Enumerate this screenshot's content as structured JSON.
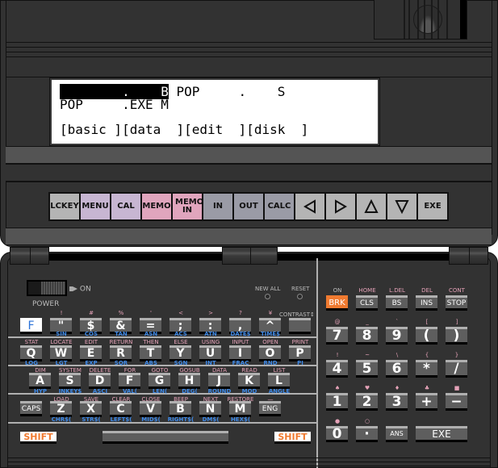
{
  "lcd": {
    "line1_inverse": "        .    B",
    "line1_rest": " POP     .    S",
    "line2": "POP     .EXE M",
    "line3": "[basic ][data  ][edit  ][disk  ]"
  },
  "function_keys": [
    {
      "label": "LCKEY",
      "color": "grey"
    },
    {
      "label": "MENU",
      "color": "lav"
    },
    {
      "label": "CAL",
      "color": "lav"
    },
    {
      "label": "MEMO",
      "color": "pink"
    },
    {
      "label": "MEMO IN",
      "color": "pink"
    },
    {
      "label": "IN",
      "color": "dark"
    },
    {
      "label": "OUT",
      "color": "dark"
    },
    {
      "label": "CALC",
      "color": "dark"
    },
    {
      "label": "",
      "icon": "left-arrow",
      "color": "grey"
    },
    {
      "label": "",
      "icon": "right-arrow",
      "color": "grey"
    },
    {
      "label": "",
      "icon": "up-arrow",
      "color": "grey"
    },
    {
      "label": "",
      "icon": "down-arrow",
      "color": "grey"
    },
    {
      "label": "EXE",
      "color": "grey"
    }
  ],
  "panel": {
    "power_label": "POWER",
    "on_label": "ON",
    "new_all_label": "NEW ALL",
    "reset_label": "RESET",
    "contrast_label": "CONTRAST"
  },
  "row1": [
    {
      "key": "F",
      "top": "",
      "bottom": ""
    },
    {
      "key": "\"",
      "top": "!",
      "bottom": "SIN"
    },
    {
      "key": "$",
      "top": "#",
      "bottom": "COS"
    },
    {
      "key": "&",
      "top": "%",
      "bottom": "TAN"
    },
    {
      "key": "=",
      "top": "'",
      "bottom": "ASN"
    },
    {
      "key": ";",
      "top": "<",
      "bottom": "ACS"
    },
    {
      "key": ":",
      "top": ">",
      "bottom": "ATN"
    },
    {
      "key": ",",
      "top": "?",
      "bottom": "DATE$"
    },
    {
      "key": "^",
      "top": "¥",
      "bottom": "TIME$"
    },
    {
      "key": "",
      "top": "",
      "bottom": ""
    }
  ],
  "row2": [
    {
      "key": "Q",
      "top": "STAT",
      "bottom": "LOG"
    },
    {
      "key": "W",
      "top": "LOCATE",
      "bottom": "LGT"
    },
    {
      "key": "E",
      "top": "EDIT",
      "bottom": "EXP"
    },
    {
      "key": "R",
      "top": "RETURN",
      "bottom": "SQR"
    },
    {
      "key": "T",
      "top": "THEN",
      "bottom": "ABS"
    },
    {
      "key": "Y",
      "top": "ELSE",
      "bottom": "SGN"
    },
    {
      "key": "U",
      "top": "USING",
      "bottom": "INT"
    },
    {
      "key": "I",
      "top": "INPUT",
      "bottom": "FRAC"
    },
    {
      "key": "O",
      "top": "OPEN",
      "bottom": "RND"
    },
    {
      "key": "P",
      "top": "PRINT",
      "bottom": "PI"
    }
  ],
  "row3": [
    {
      "key": "A",
      "top": "DIM",
      "bottom": "HYP"
    },
    {
      "key": "S",
      "top": "SYSTEM",
      "bottom": "INKEY$"
    },
    {
      "key": "D",
      "top": "DELETE",
      "bottom": "ASCI"
    },
    {
      "key": "F",
      "top": "FOR",
      "bottom": "VAL("
    },
    {
      "key": "G",
      "top": "GOTO",
      "bottom": "LEN("
    },
    {
      "key": "H",
      "top": "GOSUB",
      "bottom": "DEG("
    },
    {
      "key": "J",
      "top": "DATA",
      "bottom": "ROUND"
    },
    {
      "key": "K",
      "top": "READ",
      "bottom": "MOD"
    },
    {
      "key": "L",
      "top": "LIST",
      "bottom": "ANGLE"
    }
  ],
  "row4": [
    {
      "key": "CAPS",
      "top": "",
      "bottom": ""
    },
    {
      "key": "Z",
      "top": "LOAD",
      "bottom": "CHR$("
    },
    {
      "key": "X",
      "top": "SAVE",
      "bottom": "STR$("
    },
    {
      "key": "C",
      "top": "CLEAR",
      "bottom": "LEFT$("
    },
    {
      "key": "V",
      "top": "CLOSE",
      "bottom": "MID$("
    },
    {
      "key": "B",
      "top": "BEEP",
      "bottom": "RIGHT$("
    },
    {
      "key": "N",
      "top": "NEXT",
      "bottom": "DM$("
    },
    {
      "key": "M",
      "top": "RESTORE",
      "bottom": "HEX$("
    },
    {
      "key": "ENG",
      "top": "—",
      "bottom": ""
    }
  ],
  "row5": {
    "shift_left": "SHIFT",
    "shift_right": "SHIFT"
  },
  "numpad": [
    [
      {
        "key": "BRK",
        "top": "ON"
      },
      {
        "key": "CLS",
        "top": "HOME"
      },
      {
        "key": "BS",
        "top": "L.DEL"
      },
      {
        "key": "INS",
        "top": "DEL"
      },
      {
        "key": "STOP",
        "top": "CONT"
      }
    ],
    [
      {
        "key": "7",
        "top": "@"
      },
      {
        "key": "8",
        "top": "_"
      },
      {
        "key": "9",
        "top": "`"
      },
      {
        "key": "(",
        "top": "["
      },
      {
        "key": ")",
        "top": "]"
      }
    ],
    [
      {
        "key": "4",
        "top": "!"
      },
      {
        "key": "5",
        "top": "~"
      },
      {
        "key": "6",
        "top": "\\"
      },
      {
        "key": "*",
        "top": "{"
      },
      {
        "key": "/",
        "top": "}"
      }
    ],
    [
      {
        "key": "1",
        "top": "♠"
      },
      {
        "key": "2",
        "top": "♥"
      },
      {
        "key": "3",
        "top": "♦"
      },
      {
        "key": "+",
        "top": "♣"
      },
      {
        "key": "−",
        "top": "■"
      }
    ],
    [
      {
        "key": "0",
        "top": "●"
      },
      {
        "key": "·",
        "top": "○"
      },
      {
        "key": "ANS",
        "top": ""
      },
      {
        "key": "EXE",
        "top": ""
      }
    ]
  ]
}
